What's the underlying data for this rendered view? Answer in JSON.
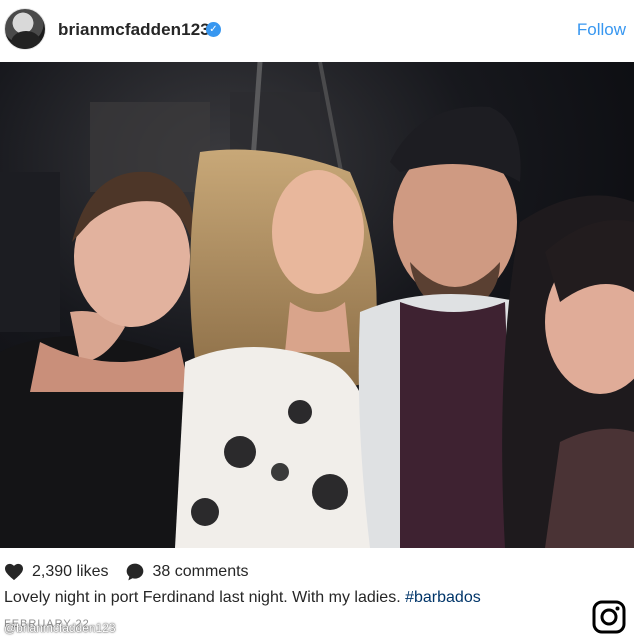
{
  "post": {
    "username": "brianmcfadden123",
    "verified_badge": "✓",
    "follow_label": "Follow",
    "likes_text": "2,390 likes",
    "comments_text": "38 comments",
    "caption_text": "Lovely night in port Ferdinand last night. With my ladies. ",
    "hashtag": "#barbados",
    "date": "FEBRUARY 22",
    "watermark": "@brianmcfadden123"
  },
  "icons": {
    "avatar": "profile-avatar",
    "verified": "verified-badge-icon",
    "heart": "heart-icon",
    "comment": "comment-icon",
    "instagram": "instagram-logo-icon"
  },
  "colors": {
    "link_blue": "#3897f0",
    "hashtag": "#003569",
    "text": "#262626",
    "muted": "#8e8e8e"
  }
}
